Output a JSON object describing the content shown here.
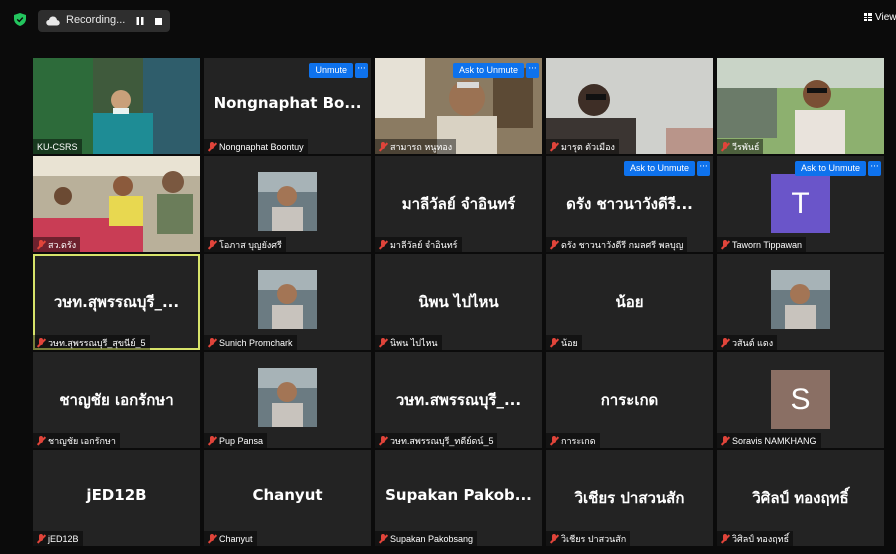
{
  "toolbar": {
    "recording_label": "Recording...",
    "view_label": "View",
    "accent_color": "#0e72ed",
    "active_speaker_color": "#d7e36a"
  },
  "participants": [
    {
      "name": "KU-CSRS",
      "video": true,
      "photo": "green"
    },
    {
      "name": "Nongnaphat Boontuy",
      "display": "Nongnaphat Bo...",
      "button": "Unmute"
    },
    {
      "name": "สามารถ หนูทอง",
      "video": true,
      "photo": "man",
      "button": "Ask to Unmute"
    },
    {
      "name": "มารุต ตัวเมือง",
      "video": true,
      "photo": "dark"
    },
    {
      "name": "วีรพันธ์",
      "video": true,
      "photo": "outdoor"
    },
    {
      "name": "สว.ดรัง",
      "video": true,
      "photo": "group"
    },
    {
      "name": "โอภาส บุญยังศรี",
      "photo_small": true
    },
    {
      "name": "มาลีวัลย์ จำอินทร์",
      "display": "มาลีวัลย์ จำอินทร์"
    },
    {
      "name": "ดรัง ชาวนาวังดีรี กมลศรี พลบุญ",
      "display": "ดรัง ชาวนาวังดีรี...",
      "button": "Ask to Unmute"
    },
    {
      "name": "Taworn Tippawan",
      "avatar": "T",
      "avatar_color": "#6a55c9",
      "button": "Ask to Unmute"
    },
    {
      "name": "วษท.สุพรรณบุรี_สุขนีย์_5",
      "display": "วษท.สุพรรณบุรี_...",
      "active": true
    },
    {
      "name": "Sunich Promchark",
      "photo_small": true
    },
    {
      "name": "นิพน ไปไหน",
      "display": "นิพน ไปไหน"
    },
    {
      "name": "น้อย",
      "display": "น้อย"
    },
    {
      "name": "วสันต์ แดง",
      "photo_small": true
    },
    {
      "name": "ชาญชัย เอกรักษา",
      "display": "ชาญชัย เอกรักษา"
    },
    {
      "name": "Pup Pansa",
      "photo_small": true
    },
    {
      "name": "วษท.สพรรณบุรี_ทดีย์ดน์_5",
      "display": "วษท.สพรรณบุรี_..."
    },
    {
      "name": "การะเกด",
      "display": "การะเกด"
    },
    {
      "name": "Soravis NAMKHANG",
      "avatar": "S",
      "avatar_color": "#8a6f64"
    },
    {
      "name": "jED12B",
      "display": "jED12B"
    },
    {
      "name": "Chanyut",
      "display": "Chanyut"
    },
    {
      "name": "Supakan Pakobsang",
      "display": "Supakan Pakob..."
    },
    {
      "name": "วิเชียร ปาสวนสัก",
      "display": "วิเชียร ปาสวนสัก"
    },
    {
      "name": "วิศิลป์ ทองฤทธิ์",
      "display": "วิศิลป์ ทองฤทธิ์"
    }
  ]
}
